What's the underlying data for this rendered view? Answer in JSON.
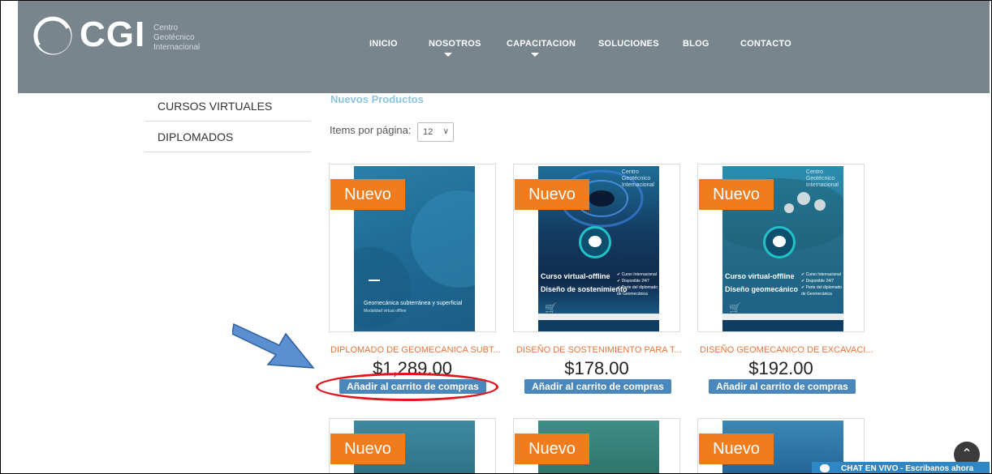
{
  "logo": {
    "brand": "CGI",
    "subtitle_lines": [
      "Centro",
      "Geotécnico",
      "Internacional"
    ]
  },
  "nav": {
    "items": [
      {
        "label": "INICIO"
      },
      {
        "label": "NOSOTROS"
      },
      {
        "label": "CAPACITACION"
      },
      {
        "label": "SOLUCIONES"
      },
      {
        "label": "BLOG"
      },
      {
        "label": "CONTACTO"
      }
    ]
  },
  "sidebar": {
    "items": [
      {
        "label": "CURSOS VIRTUALES"
      },
      {
        "label": "DIPLOMADOS"
      }
    ]
  },
  "main": {
    "section_title": "Nuevos Productos",
    "per_page_label": "Items por página:",
    "per_page_value": "12"
  },
  "products": [
    {
      "badge": "Nuevo",
      "title": "DIPLOMADO DE GEOMECANICA SUBT...",
      "price": "$1,289.00",
      "cart_label": "Añadir al carrito de compras",
      "cover_text": [
        "Geomecánica subterránea y superficial",
        "Modalidad virtual offline"
      ]
    },
    {
      "badge": "Nuevo",
      "title": "DISEÑO DE SOSTENIMIENTO PARA T...",
      "price": "$178.00",
      "cart_label": "Añadir al carrito de compras",
      "cover_text": [
        "Curso virtual-offline",
        "Diseño de sostenimiento"
      ]
    },
    {
      "badge": "Nuevo",
      "title": "DISEÑO GEOMECANICO DE EXCAVACI...",
      "price": "$192.00",
      "cart_label": "Añadir al carrito de compras",
      "cover_text": [
        "Curso virtual-offline",
        "Diseño geomecánico"
      ]
    }
  ],
  "cover_bullets": [
    "✔ Curso Internacional",
    "✔ Disponible 24/7",
    "✔ Parte del diplomado",
    "de Geomecánica"
  ],
  "cover_brand": [
    "Centro",
    "Geotécnico",
    "Internacional"
  ],
  "row2_badges": [
    "Nuevo",
    "Nuevo",
    "Nuevo"
  ],
  "chat": {
    "label": "CHAT EN VIVO - Escribanos ahora"
  },
  "colors": {
    "header_bg": "#78858d",
    "badge_orange": "#f07c1e",
    "cart_button": "#4a87ba",
    "product_title": "#e5753a",
    "section_title": "#8dc3dc",
    "highlight_red": "#e3141b",
    "arrow_blue": "#5a8fd2"
  }
}
